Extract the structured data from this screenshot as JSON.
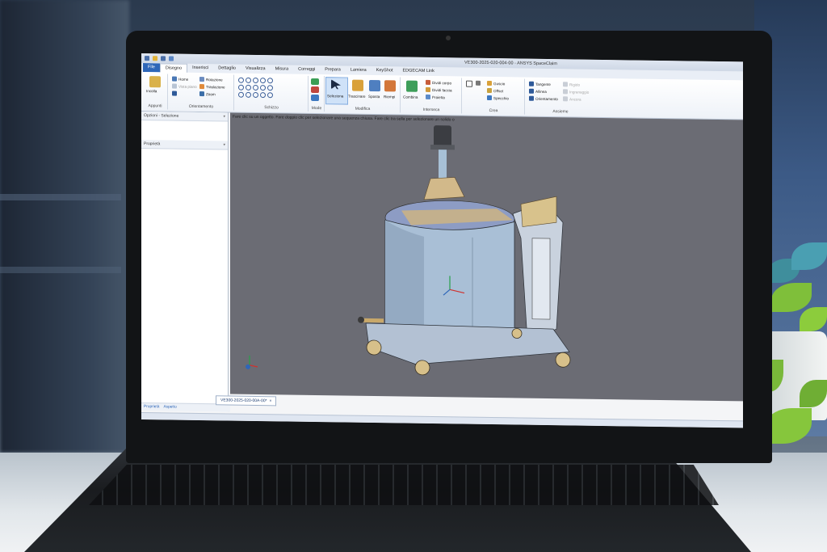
{
  "window": {
    "document_title": "VE300-2025-020-004-00 - ANSYS SpaceClaim"
  },
  "ribbon": {
    "tabs": [
      {
        "label": "File",
        "kind": "file"
      },
      {
        "label": "Disegno",
        "kind": "active"
      },
      {
        "label": "Inserisci",
        "kind": ""
      },
      {
        "label": "Dettaglio",
        "kind": ""
      },
      {
        "label": "Visualizza",
        "kind": ""
      },
      {
        "label": "Misura",
        "kind": ""
      },
      {
        "label": "Correggi",
        "kind": ""
      },
      {
        "label": "Prepara",
        "kind": ""
      },
      {
        "label": "Lamiera",
        "kind": ""
      },
      {
        "label": "KeyShot",
        "kind": ""
      },
      {
        "label": "EDGECAM Link",
        "kind": ""
      }
    ],
    "appunti": {
      "paste": "Incolla",
      "label": "Appunti"
    },
    "orientamento": {
      "home": "Home",
      "rotation": "Rotazione",
      "plane_view": "Vista piano",
      "translate": "Traslazione",
      "zoom": "Zoom",
      "label": "Orientamento"
    },
    "schizzo": {
      "label": "Schizzo"
    },
    "mode": {
      "label": "Mode"
    },
    "modifica": {
      "select": "Seleziona",
      "pull": "Trascinare",
      "move": "Sposta",
      "fill": "Riempi",
      "label": "Modifica"
    },
    "interseca": {
      "combine": "Combina",
      "split_body": "Dividi corpo",
      "split_face": "Dividi faccia",
      "project": "Proietta",
      "label": "Interseca"
    },
    "crea": {
      "shell": "Guscio",
      "offset": "Offset",
      "mirror": "Specchio",
      "label": "Crea"
    },
    "assieme": {
      "tangent": "Tangente",
      "align": "Allinea",
      "orient": "Orientamento",
      "rigid": "Rigido",
      "gear": "Ingranaggio",
      "anchor": "Ancora",
      "label": "Assieme"
    }
  },
  "panels": {
    "structure": "Opzioni - Selezione",
    "properties": "Proprietà",
    "bottom_tabs": [
      "Proprietà",
      "Aspetto"
    ]
  },
  "viewport": {
    "hint": "Fare clic su un oggetto. Fare doppio clic per selezionare una sequenza chiusa. Fare clic tra sella per selezionare un solido o"
  },
  "document_tab": {
    "label": "VE300-2025-020-00A-00*",
    "close": "×"
  },
  "colors": {
    "accent": "#2e66b8",
    "viewport_bg": "#6b6c74",
    "tank": "#9fb4cc",
    "frame": "#d6dde8",
    "brass": "#c8a86a"
  }
}
